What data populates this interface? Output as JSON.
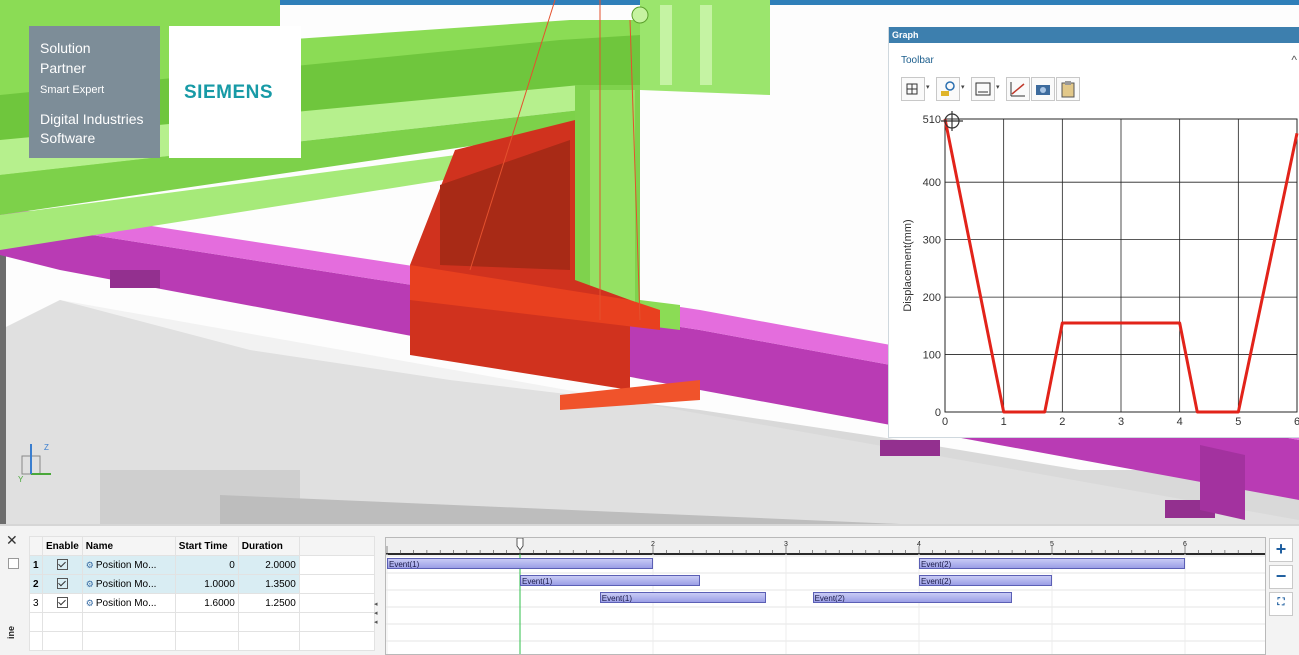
{
  "badge": {
    "line1": "Solution",
    "line2": "Partner",
    "line3": "Smart Expert",
    "line4": "Digital Industries",
    "line5": "Software",
    "logo": "SIEMENS"
  },
  "graph": {
    "title": "Graph",
    "toolbar_label": "Toolbar",
    "collapse_icon": "chevron-up-icon",
    "tools": [
      "table-icon",
      "probe-icon",
      "fit-icon",
      "line-style-icon",
      "camera-icon",
      "clipboard-icon"
    ],
    "chart_data": {
      "type": "line",
      "title": "",
      "xlabel": "",
      "ylabel": "Displacement(mm)",
      "xlim": [
        0,
        6
      ],
      "ylim": [
        0,
        510
      ],
      "x_ticks": [
        "0",
        "1",
        "2",
        "3",
        "4",
        "5",
        "6"
      ],
      "y_ticks": [
        "0",
        "100",
        "200",
        "300",
        "400",
        "510"
      ],
      "grid": true,
      "series": [
        {
          "color": "#e2231a",
          "x": [
            0,
            1.0,
            1.7,
            2.0,
            4.0,
            4.3,
            5.0,
            6.0
          ],
          "y": [
            510,
            0,
            0,
            155,
            155,
            0,
            0,
            485
          ]
        }
      ]
    }
  },
  "timeline": {
    "close_icon": "close-icon",
    "side_label": "ine",
    "columns": [
      "Enable",
      "Name",
      "Start Time",
      "Duration"
    ],
    "rows": [
      {
        "index": "1",
        "name": "Position Mo...",
        "start": "0",
        "duration": "2.0000",
        "selected": true
      },
      {
        "index": "2",
        "name": "Position Mo...",
        "start": "1.0000",
        "duration": "1.3500",
        "selected": true
      },
      {
        "index": "3",
        "name": "Position Mo...",
        "start": "1.6000",
        "duration": "1.2500",
        "selected": false
      }
    ],
    "ruler_labels": [
      "2",
      "3",
      "4",
      "5",
      "6"
    ],
    "cursor_time": 1.0,
    "events": [
      {
        "label": "Event(1)",
        "row": 0,
        "start": 0.0,
        "end": 2.0
      },
      {
        "label": "Event(2)",
        "row": 0,
        "start": 4.0,
        "end": 6.0
      },
      {
        "label": "Event(1)",
        "row": 1,
        "start": 1.0,
        "end": 2.35
      },
      {
        "label": "Event(2)",
        "row": 1,
        "start": 4.0,
        "end": 5.0
      },
      {
        "label": "Event(1)",
        "row": 2,
        "start": 1.6,
        "end": 2.85
      },
      {
        "label": "Event(2)",
        "row": 2,
        "start": 3.2,
        "end": 4.7
      }
    ],
    "side_buttons": {
      "add": "+",
      "remove": "−",
      "fit_icon": "fit-view-icon"
    }
  }
}
